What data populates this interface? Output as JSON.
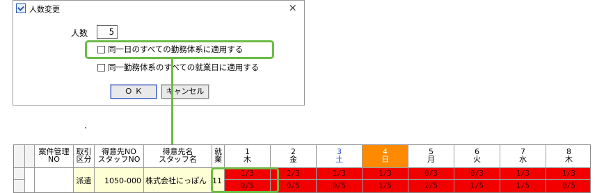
{
  "dialog": {
    "title": "人数変更",
    "close_glyph": "×",
    "count_label": "人数",
    "count_value": "5",
    "check_same_day": "同一日のすべての勤務体系に適用する",
    "check_same_shift": "同一勤務体系のすべての就業日に適用する",
    "ok_label": "Ｏ Ｋ",
    "cancel_label": "キャンセル"
  },
  "grid": {
    "headers": {
      "case_no_1": "案件管理",
      "case_no_2": "NO",
      "deal_1": "取引",
      "deal_2": "区分",
      "client_1": "得意先NO",
      "client_2": "スタッフNO",
      "client_name_1": "得意先名",
      "client_name_2": "スタッフ名",
      "work_1": "就",
      "work_2": "業"
    },
    "days": [
      {
        "num": "1",
        "dow": "木"
      },
      {
        "num": "2",
        "dow": "金"
      },
      {
        "num": "3",
        "dow": "土"
      },
      {
        "num": "4",
        "dow": "日"
      },
      {
        "num": "5",
        "dow": "月"
      },
      {
        "num": "6",
        "dow": "火"
      },
      {
        "num": "7",
        "dow": "水"
      },
      {
        "num": "8",
        "dow": "木"
      }
    ],
    "row": {
      "deal": "派遣",
      "client_no": "1050-000",
      "client_name": "株式会社にっぽん",
      "work_fragment": "11",
      "top_values": [
        "1/3",
        "2/3",
        "1/3",
        "1/3",
        "0/3",
        "0/3",
        "1/3",
        "1/3"
      ],
      "bottom_values": [
        "0/5",
        "0/5",
        "0/5",
        "1/5",
        "2/5",
        "1/5",
        "1/5",
        "0/5"
      ]
    }
  },
  "colors": {
    "highlight": "#6dbb45",
    "shortage_red": "#f20000",
    "sunday_orange": "#ff8a00",
    "saturday_blue": "#1a3fd6"
  }
}
